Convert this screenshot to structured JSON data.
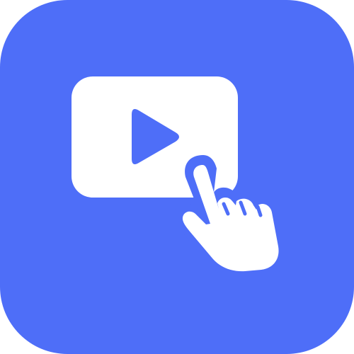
{
  "icon": {
    "name": "video-tap-app-icon",
    "description_icons": [
      "play-video-icon",
      "pointing-hand-icon"
    ],
    "colors": {
      "background": "#4E6EF8",
      "foreground": "#FFFFFF",
      "play_triangle": "#4E6EF8"
    }
  }
}
